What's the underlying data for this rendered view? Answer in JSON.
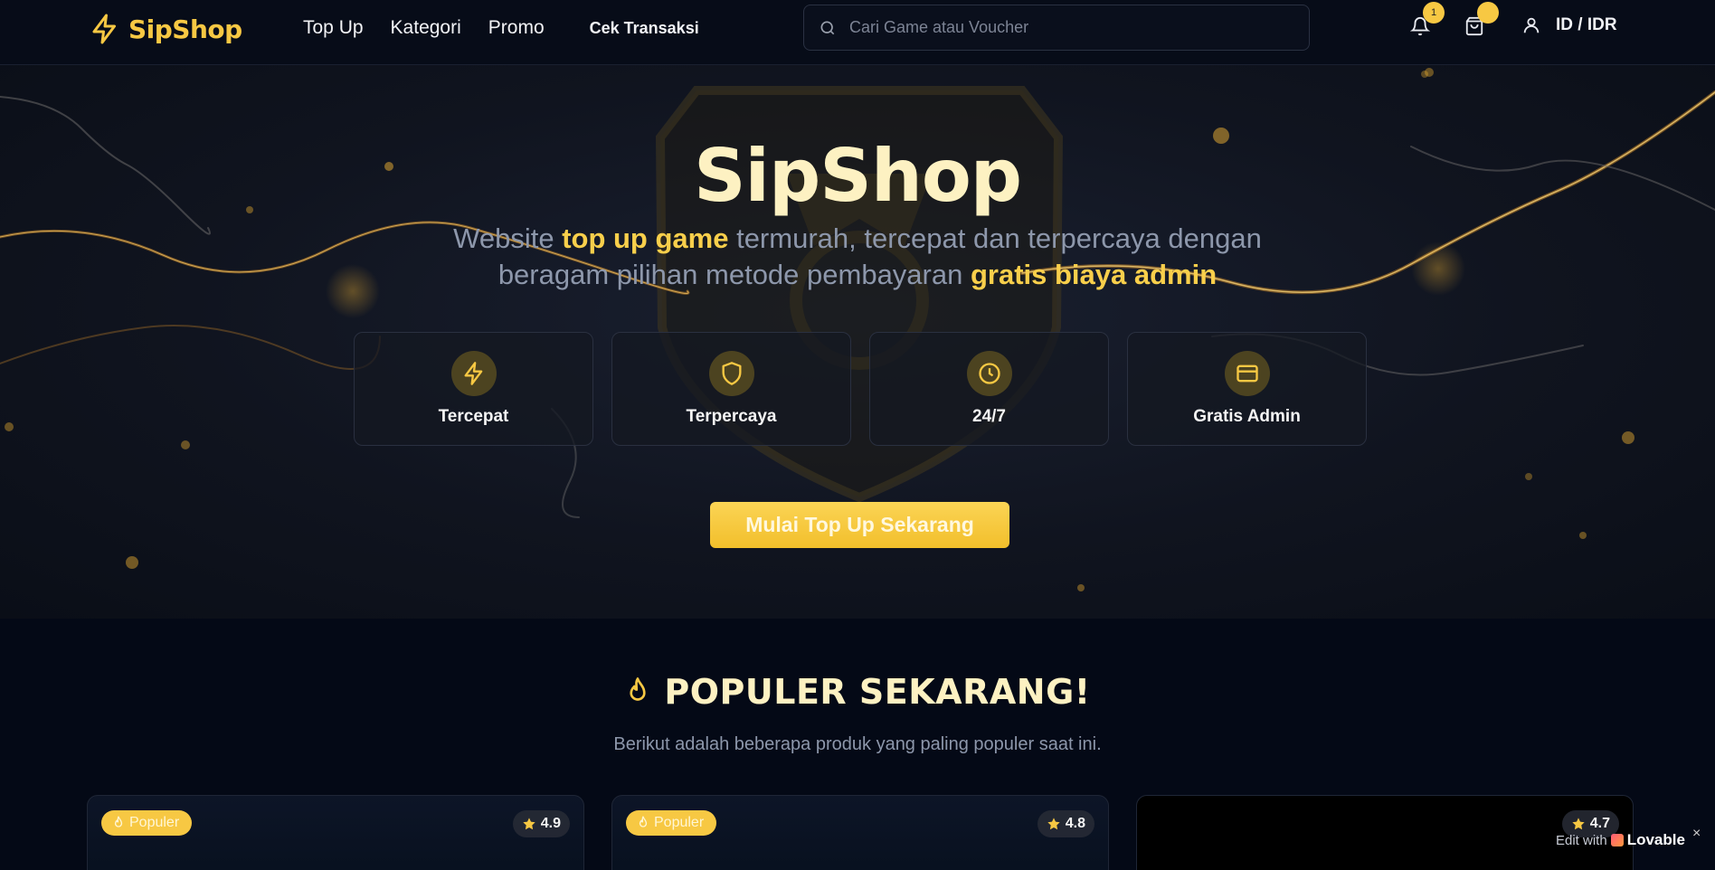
{
  "navbar": {
    "brand": "SipShop",
    "links": [
      "Top Up",
      "Kategori",
      "Promo"
    ],
    "check_transaction": "Cek Transaksi",
    "search_placeholder": "Cari Game atau Voucher",
    "notifications_count": "1",
    "cart_count": "",
    "account_label": "ID / IDR"
  },
  "hero": {
    "title": "SipShop",
    "subtitle_parts": [
      "Website ",
      "top up game",
      " termurah, tercepat dan terpercaya dengan beragam pilihan metode pembayaran ",
      "gratis biaya admin"
    ],
    "features": [
      {
        "label": "Tercepat",
        "icon": "lightning-icon"
      },
      {
        "label": "Terpercaya",
        "icon": "shield-icon"
      },
      {
        "label": "24/7",
        "icon": "clock-icon"
      },
      {
        "label": "Gratis Admin",
        "icon": "credit-card-icon"
      }
    ],
    "cta": "Mulai Top Up Sekarang"
  },
  "popular": {
    "title": "POPULER SEKARANG!",
    "subtitle": "Berikut adalah beberapa produk yang paling populer saat ini.",
    "cards": [
      {
        "badge": "Populer",
        "rating": "4.9"
      },
      {
        "badge": "Populer",
        "rating": "4.8"
      },
      {
        "badge": "",
        "rating": "4.7"
      }
    ]
  },
  "lovable": {
    "prefix": "Edit with",
    "brand": "Lovable",
    "close": "×"
  },
  "colors": {
    "accent": "#f7c843",
    "background": "#040916",
    "text_muted": "#8d97ab"
  }
}
